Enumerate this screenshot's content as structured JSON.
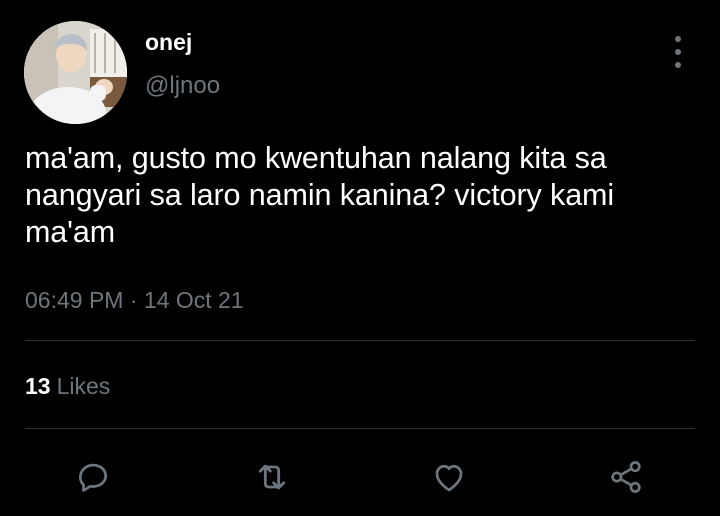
{
  "user": {
    "display_name": "onej",
    "handle": "@ljnoo"
  },
  "tweet": {
    "text": "ma'am, gusto mo kwentuhan nalang kita sa nangyari sa laro namin kanina? victory kami ma'am",
    "time": "06:49 PM",
    "separator": "·",
    "date": "14 Oct 21"
  },
  "stats": {
    "likes_count": "13",
    "likes_label": "Likes"
  },
  "actions": [
    "reply-icon",
    "retweet-icon",
    "like-icon",
    "share-icon"
  ],
  "colors": {
    "background": "#000000",
    "text": "#ffffff",
    "secondary": "#6e767d",
    "divider": "#2f3336"
  }
}
